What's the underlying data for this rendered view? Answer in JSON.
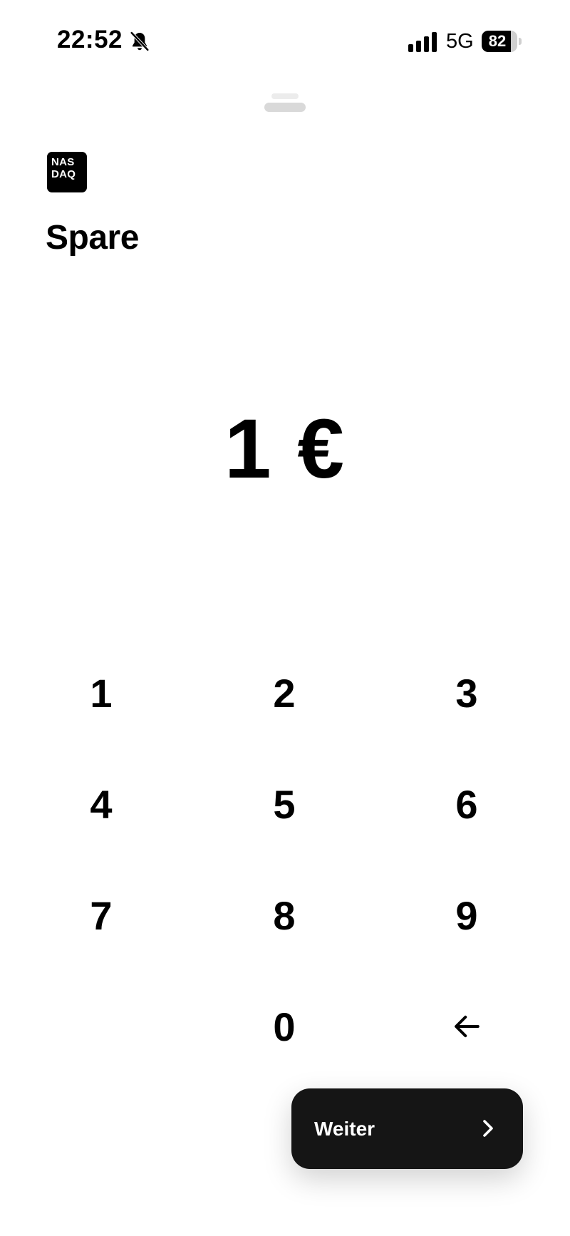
{
  "status_bar": {
    "time": "22:52",
    "mute_icon": "bell-slash-icon",
    "signal_icon": "cellular-signal-icon",
    "network": "5G",
    "battery_level": "82",
    "battery_fraction": 0.82
  },
  "header": {
    "logo": {
      "line1": "NAS",
      "line2": "DAQ"
    },
    "title": "Spare"
  },
  "amount": {
    "display": "1 €"
  },
  "keypad": {
    "keys": [
      "1",
      "2",
      "3",
      "4",
      "5",
      "6",
      "7",
      "8",
      "9",
      "0"
    ],
    "backspace_icon": "arrow-left-icon"
  },
  "continue_button": {
    "label": "Weiter",
    "icon": "chevron-right-icon"
  },
  "colors": {
    "background": "#ffffff",
    "text": "#000000",
    "button": "#151515",
    "handle": "#d9d9d9"
  }
}
